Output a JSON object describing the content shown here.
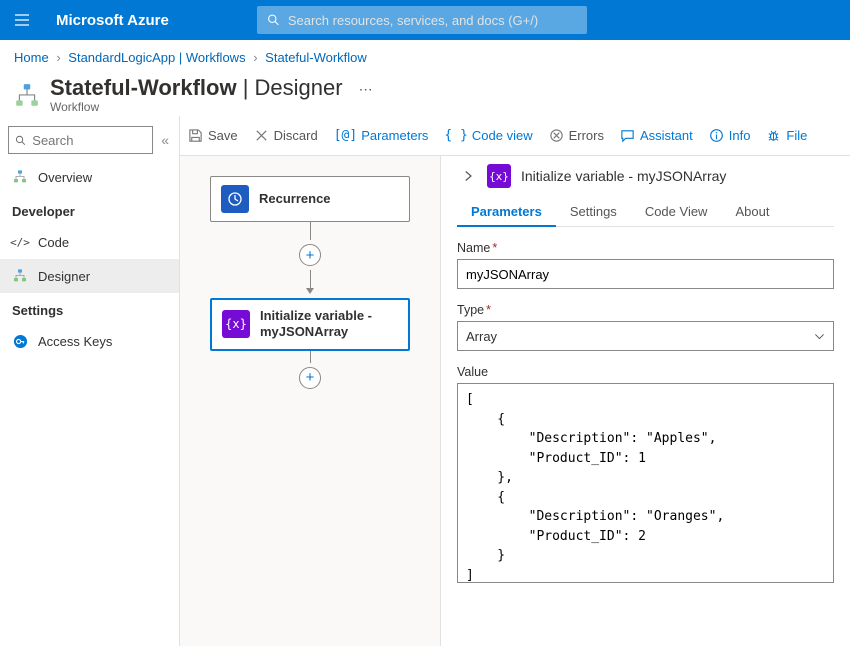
{
  "topbar": {
    "brand": "Microsoft Azure",
    "search_placeholder": "Search resources, services, and docs (G+/)"
  },
  "breadcrumbs": {
    "items": [
      "Home",
      "StandardLogicApp | Workflows",
      "Stateful-Workflow"
    ]
  },
  "title": {
    "main": "Stateful-Workflow",
    "section": "Designer",
    "subtitle": "Workflow",
    "divider": " | "
  },
  "leftnav": {
    "search_placeholder": "Search",
    "items_top": [
      {
        "label": "Overview"
      }
    ],
    "dev_header": "Developer",
    "items_dev": [
      {
        "label": "Code"
      },
      {
        "label": "Designer",
        "active": true
      }
    ],
    "settings_header": "Settings",
    "items_settings": [
      {
        "label": "Access Keys"
      }
    ]
  },
  "toolbar": {
    "save": "Save",
    "discard": "Discard",
    "parameters": "Parameters",
    "codeview": "Code view",
    "errors": "Errors",
    "assistant": "Assistant",
    "info": "Info",
    "file": "File"
  },
  "canvas": {
    "nodes": [
      {
        "label": "Recurrence"
      },
      {
        "label": "Initialize variable - myJSONArray"
      }
    ]
  },
  "panel": {
    "title": "Initialize variable - myJSONArray",
    "tabs": [
      "Parameters",
      "Settings",
      "Code View",
      "About"
    ],
    "active_tab": "Parameters",
    "fields": {
      "name_label": "Name",
      "name_value": "myJSONArray",
      "type_label": "Type",
      "type_value": "Array",
      "value_label": "Value",
      "value_text": "[\n    {\n        \"Description\": \"Apples\",\n        \"Product_ID\": 1\n    },\n    {\n        \"Description\": \"Oranges\",\n        \"Product_ID\": 2\n    }\n]"
    }
  }
}
